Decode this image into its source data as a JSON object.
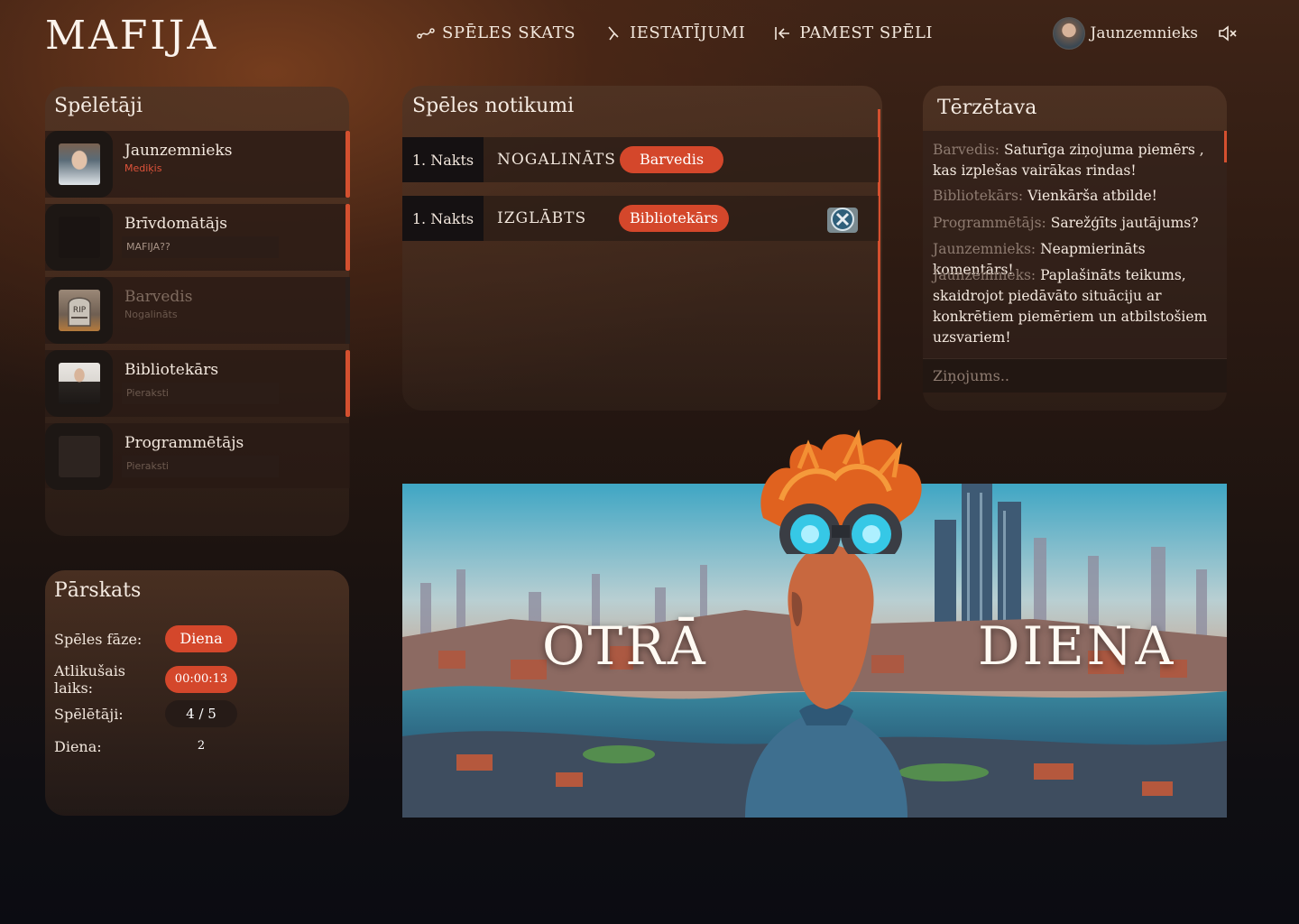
{
  "app": {
    "logo": "MAFIJA"
  },
  "nav": {
    "view": "SPĒLES SKATS",
    "settings": "IESTATĪJUMI",
    "leave": "PAMEST SPĒLI"
  },
  "user": {
    "name": "Jaunzemnieks"
  },
  "players_panel": {
    "title": "Spēlētāji",
    "players": [
      {
        "name": "Jaunzemnieks",
        "role": "Mediķis",
        "role_color": "#e0533a"
      },
      {
        "name": "Brīvdomātājs",
        "note_placeholder": "MAFIJA??"
      },
      {
        "name": "Barvedis",
        "role": "Nogalināts"
      },
      {
        "name": "Bibliotekārs",
        "note_placeholder": "Pieraksti"
      },
      {
        "name": "Programmētājs",
        "note_placeholder": "Pieraksti"
      }
    ]
  },
  "overview": {
    "title": "Pārskats",
    "phase_label": "Spēles fāze:",
    "phase_value": "Diena",
    "time_label": "Atlikušais laiks:",
    "time_value": "00:00:13",
    "players_label": "Spēlētāji:",
    "players_value": "4 / 5",
    "day_label": "Diena:",
    "day_value": "2"
  },
  "events": {
    "title": "Spēles notikumi",
    "items": [
      {
        "tag": "1. Nakts",
        "type": "NOGALINĀTS",
        "player": "Barvedis"
      },
      {
        "tag": "1. Nakts",
        "type": "IZGLĀBTS",
        "player": "Bibliotekārs"
      }
    ]
  },
  "chat": {
    "title": "Tērzētava",
    "messages": [
      {
        "author": "Barvedis:",
        "text": "Saturīga ziņojuma piemērs , kas izplešas vairākas rindas!"
      },
      {
        "author": "Bibliotekārs:",
        "text": "Vienkārša atbilde!"
      },
      {
        "author": "Programmētājs:",
        "text": "Sarežģīts jautājums?"
      },
      {
        "author": "Jaunzemnieks:",
        "text": "Neapmierināts komentārs!"
      },
      {
        "author": "Jaunzemnieks:",
        "text": "Paplašināts teikums, skaidrojot piedāvāto situāciju ar konkrētiem piemēriem un atbilstošiem uzsvariem!"
      }
    ],
    "input_placeholder": "Ziņojums.."
  },
  "banner": {
    "word_left": "OTRĀ",
    "word_right": "DIENA"
  },
  "colors": {
    "accent": "#d4472b",
    "muted": "#8e7b70"
  }
}
